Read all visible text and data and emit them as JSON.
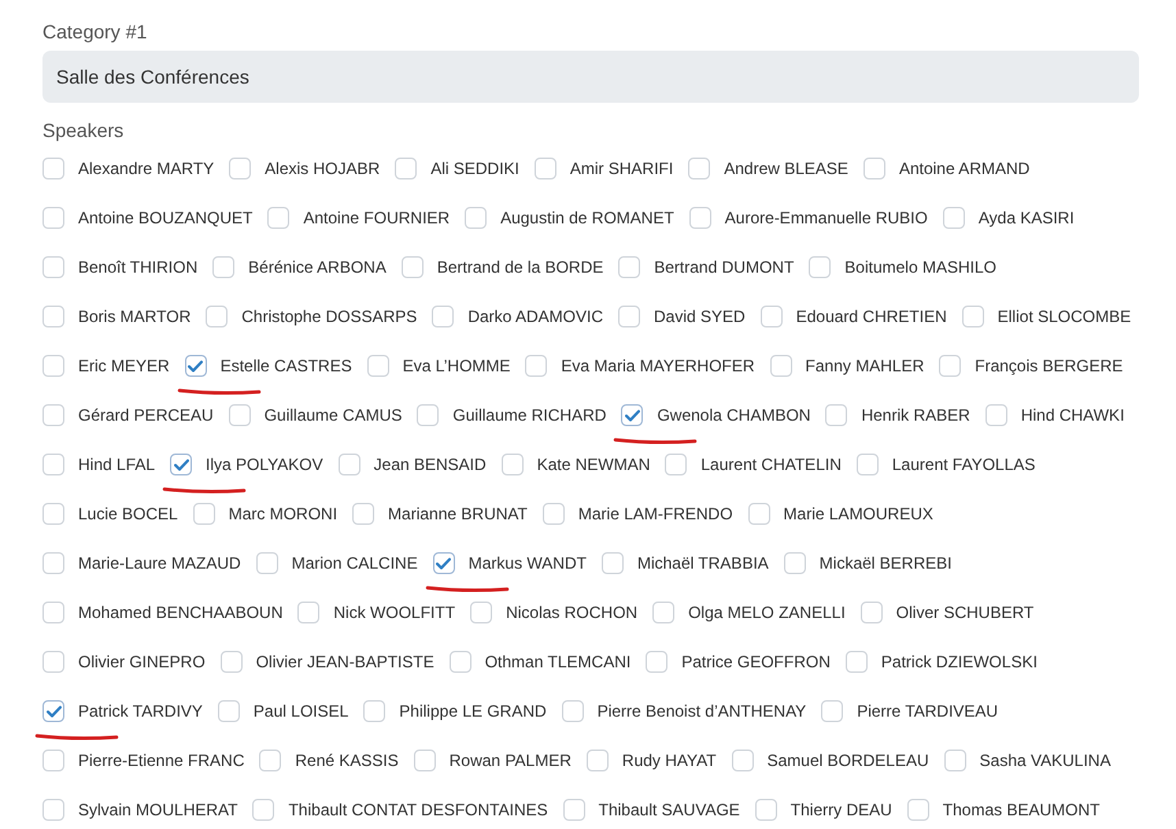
{
  "category": {
    "label": "Category #1",
    "value": "Salle des Conférences"
  },
  "speakers_label": "Speakers",
  "speaker_rows": [
    {
      "items": [
        {
          "name": "Alexandre MARTY",
          "checked": false,
          "underlined": false
        },
        {
          "name": "Alexis HOJABR",
          "checked": false,
          "underlined": false
        },
        {
          "name": "Ali SEDDIKI",
          "checked": false,
          "underlined": false
        },
        {
          "name": "Amir SHARIFI",
          "checked": false,
          "underlined": false
        },
        {
          "name": "Andrew BLEASE",
          "checked": false,
          "underlined": false
        },
        {
          "name": "Antoine ARMAND",
          "checked": false,
          "underlined": false
        }
      ]
    },
    {
      "items": [
        {
          "name": "Antoine BOUZANQUET",
          "checked": false,
          "underlined": false
        },
        {
          "name": "Antoine FOURNIER",
          "checked": false,
          "underlined": false
        },
        {
          "name": "Augustin de ROMANET",
          "checked": false,
          "underlined": false
        },
        {
          "name": "Aurore-Emmanuelle RUBIO",
          "checked": false,
          "underlined": false
        },
        {
          "name": "Ayda KASIRI",
          "checked": false,
          "underlined": false
        }
      ]
    },
    {
      "items": [
        {
          "name": "Benoît THIRION",
          "checked": false,
          "underlined": false
        },
        {
          "name": "Bérénice ARBONA",
          "checked": false,
          "underlined": false
        },
        {
          "name": "Bertrand de la BORDE",
          "checked": false,
          "underlined": false
        },
        {
          "name": "Bertrand DUMONT",
          "checked": false,
          "underlined": false
        },
        {
          "name": "Boitumelo MASHILO",
          "checked": false,
          "underlined": false
        }
      ]
    },
    {
      "items": [
        {
          "name": "Boris MARTOR",
          "checked": false,
          "underlined": false
        },
        {
          "name": "Christophe DOSSARPS",
          "checked": false,
          "underlined": false
        },
        {
          "name": "Darko ADAMOVIC",
          "checked": false,
          "underlined": false
        },
        {
          "name": "David SYED",
          "checked": false,
          "underlined": false
        },
        {
          "name": "Edouard CHRETIEN",
          "checked": false,
          "underlined": false
        },
        {
          "name": "Elliot SLOCOMBE",
          "checked": false,
          "underlined": false
        }
      ]
    },
    {
      "items": [
        {
          "name": "Eric MEYER",
          "checked": false,
          "underlined": false
        },
        {
          "name": "Estelle CASTRES",
          "checked": true,
          "underlined": true
        },
        {
          "name": "Eva L’HOMME",
          "checked": false,
          "underlined": false
        },
        {
          "name": "Eva Maria MAYERHOFER",
          "checked": false,
          "underlined": false
        },
        {
          "name": "Fanny MAHLER",
          "checked": false,
          "underlined": false
        },
        {
          "name": "François BERGERE",
          "checked": false,
          "underlined": false
        }
      ]
    },
    {
      "items": [
        {
          "name": "Gérard PERCEAU",
          "checked": false,
          "underlined": false
        },
        {
          "name": "Guillaume CAMUS",
          "checked": false,
          "underlined": false
        },
        {
          "name": "Guillaume RICHARD",
          "checked": false,
          "underlined": false
        },
        {
          "name": "Gwenola CHAMBON",
          "checked": true,
          "underlined": true
        },
        {
          "name": "Henrik RABER",
          "checked": false,
          "underlined": false
        },
        {
          "name": "Hind CHAWKI",
          "checked": false,
          "underlined": false
        }
      ]
    },
    {
      "items": [
        {
          "name": "Hind LFAL",
          "checked": false,
          "underlined": false
        },
        {
          "name": "Ilya POLYAKOV",
          "checked": true,
          "underlined": true
        },
        {
          "name": "Jean BENSAID",
          "checked": false,
          "underlined": false
        },
        {
          "name": "Kate NEWMAN",
          "checked": false,
          "underlined": false
        },
        {
          "name": "Laurent CHATELIN",
          "checked": false,
          "underlined": false
        },
        {
          "name": "Laurent FAYOLLAS",
          "checked": false,
          "underlined": false
        }
      ]
    },
    {
      "items": [
        {
          "name": "Lucie BOCEL",
          "checked": false,
          "underlined": false
        },
        {
          "name": "Marc MORONI",
          "checked": false,
          "underlined": false
        },
        {
          "name": "Marianne BRUNAT",
          "checked": false,
          "underlined": false
        },
        {
          "name": "Marie LAM-FRENDO",
          "checked": false,
          "underlined": false
        },
        {
          "name": "Marie LAMOUREUX",
          "checked": false,
          "underlined": false
        }
      ]
    },
    {
      "items": [
        {
          "name": "Marie-Laure MAZAUD",
          "checked": false,
          "underlined": false
        },
        {
          "name": "Marion CALCINE",
          "checked": false,
          "underlined": false
        },
        {
          "name": "Markus WANDT",
          "checked": true,
          "underlined": true
        },
        {
          "name": "Michaël TRABBIA",
          "checked": false,
          "underlined": false
        },
        {
          "name": "Mickaël BERREBI",
          "checked": false,
          "underlined": false
        }
      ]
    },
    {
      "items": [
        {
          "name": "Mohamed BENCHAABOUN",
          "checked": false,
          "underlined": false
        },
        {
          "name": "Nick WOOLFITT",
          "checked": false,
          "underlined": false
        },
        {
          "name": "Nicolas ROCHON",
          "checked": false,
          "underlined": false
        },
        {
          "name": "Olga MELO ZANELLI",
          "checked": false,
          "underlined": false
        },
        {
          "name": "Oliver SCHUBERT",
          "checked": false,
          "underlined": false
        }
      ]
    },
    {
      "items": [
        {
          "name": "Olivier GINEPRO",
          "checked": false,
          "underlined": false
        },
        {
          "name": "Olivier JEAN-BAPTISTE",
          "checked": false,
          "underlined": false
        },
        {
          "name": "Othman TLEMCANI",
          "checked": false,
          "underlined": false
        },
        {
          "name": "Patrice GEOFFRON",
          "checked": false,
          "underlined": false
        },
        {
          "name": "Patrick DZIEWOLSKI",
          "checked": false,
          "underlined": false
        }
      ]
    },
    {
      "items": [
        {
          "name": "Patrick TARDIVY",
          "checked": true,
          "underlined": true
        },
        {
          "name": "Paul LOISEL",
          "checked": false,
          "underlined": false
        },
        {
          "name": "Philippe LE GRAND",
          "checked": false,
          "underlined": false
        },
        {
          "name": "Pierre Benoist d’ANTHENAY",
          "checked": false,
          "underlined": false
        },
        {
          "name": "Pierre TARDIVEAU",
          "checked": false,
          "underlined": false
        }
      ]
    },
    {
      "items": [
        {
          "name": "Pierre-Etienne FRANC",
          "checked": false,
          "underlined": false
        },
        {
          "name": "René KASSIS",
          "checked": false,
          "underlined": false
        },
        {
          "name": "Rowan PALMER",
          "checked": false,
          "underlined": false
        },
        {
          "name": "Rudy HAYAT",
          "checked": false,
          "underlined": false
        },
        {
          "name": "Samuel BORDELEAU",
          "checked": false,
          "underlined": false
        },
        {
          "name": "Sasha VAKULINA",
          "checked": false,
          "underlined": false
        }
      ]
    },
    {
      "items": [
        {
          "name": "Sylvain MOULHERAT",
          "checked": false,
          "underlined": false
        },
        {
          "name": "Thibault CONTAT DESFONTAINES",
          "checked": false,
          "underlined": false
        },
        {
          "name": "Thibault SAUVAGE",
          "checked": false,
          "underlined": false
        },
        {
          "name": "Thierry DEAU",
          "checked": false,
          "underlined": false
        },
        {
          "name": "Thomas BEAUMONT",
          "checked": false,
          "underlined": false
        }
      ]
    }
  ]
}
